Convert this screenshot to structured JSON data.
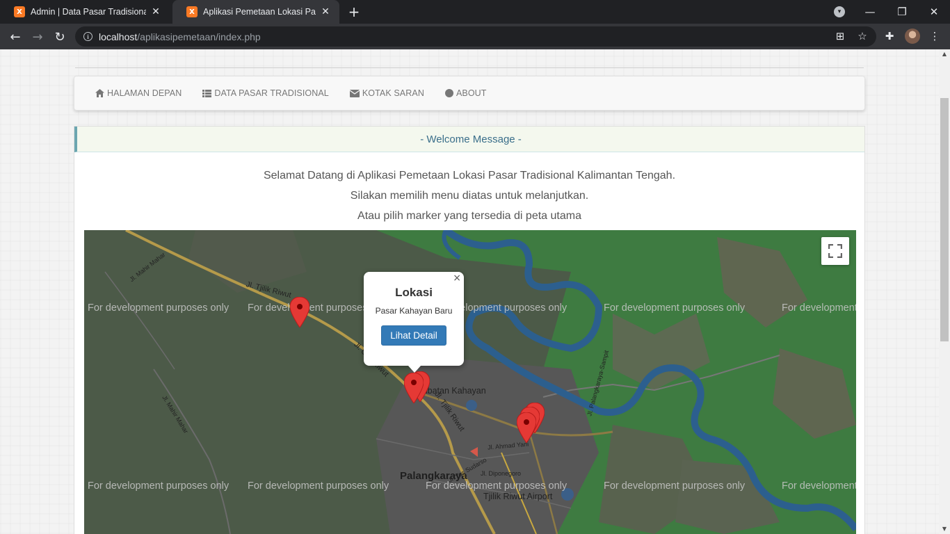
{
  "browser": {
    "tabs": [
      {
        "title": "Admin | Data Pasar Tradisional",
        "active": false
      },
      {
        "title": "Aplikasi Pemetaan Lokasi Pasar Tradisional",
        "active": true
      }
    ],
    "url_host": "localhost",
    "url_path": "/aplikasipemetaan/index.php",
    "icons": {
      "back": "back-arrow-icon",
      "forward": "forward-arrow-icon",
      "reload": "reload-icon"
    }
  },
  "nav": {
    "items": [
      {
        "label": "HALAMAN DEPAN",
        "icon": "home-icon"
      },
      {
        "label": "DATA PASAR TRADISIONAL",
        "icon": "list-icon"
      },
      {
        "label": "KOTAK SARAN",
        "icon": "envelope-icon"
      },
      {
        "label": "ABOUT",
        "icon": "circle-icon"
      }
    ]
  },
  "panel": {
    "heading": "- Welcome Message -",
    "lines": [
      "Selamat Datang di Aplikasi Pemetaan Lokasi Pasar Tradisional Kalimantan Tengah.",
      "Silakan memilih menu diatas untuk melanjutkan.",
      "Atau pilih marker yang tersedia di peta utama"
    ]
  },
  "map": {
    "watermark": "For development purposes only",
    "labels": {
      "road1": "Jl. Tjilik Riwut",
      "road2": "Jl. Tjilik Riwut",
      "road3": "Jl. Ahmad Yani",
      "road4": "Jl. Yos Sudarso",
      "road5": "Jl. Diponegoro",
      "road6": "Jl. Palangkaraya-Sampit",
      "road7": "Jl. Mahir Mahar",
      "road8": "Jl. Mahir Mahar",
      "road9": "Jl. Cilik Riwut",
      "bridge": "Jembatan Kahayan",
      "airport": "Tjilik Riwut Airport",
      "city": "Palangkaraya"
    },
    "infowindow": {
      "title": "Lokasi",
      "subtitle": "Pasar Kahayan Baru",
      "button": "Lihat Detail",
      "close": "×"
    },
    "colors": {
      "land": "#3d7a40",
      "urban": "#5a5a5a",
      "river": "#2b5b8a",
      "marker": "#e53935"
    }
  }
}
